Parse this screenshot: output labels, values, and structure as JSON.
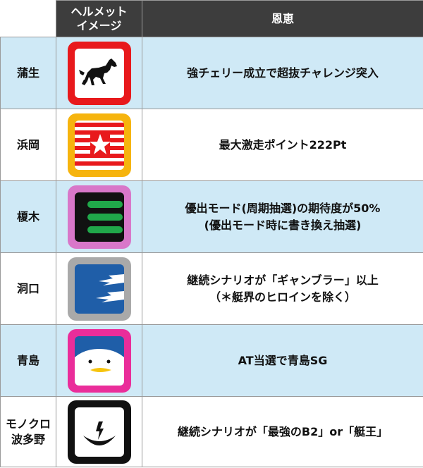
{
  "header": {
    "col_name": "",
    "col_helmet": "ヘルメット\nイメージ",
    "col_benefit": "恩恵"
  },
  "rows": [
    {
      "name": "蒲生",
      "benefit": "強チェリー成立で超抜チャレンジ突入",
      "icon": "horse-helmet-icon",
      "frame": "#e8191c"
    },
    {
      "name": "浜岡",
      "benefit": "最大激走ポイント222Pt",
      "icon": "star-stripes-helmet-icon",
      "frame": "#f6b40e"
    },
    {
      "name": "榎木",
      "benefit": "優出モード(周期抽選)の期待度が50%\n(優出モード時に書き換え抽選)",
      "icon": "green-bars-helmet-icon",
      "frame": "#d877c9"
    },
    {
      "name": "洞口",
      "benefit": "継続シナリオが「ギャンブラー」以上\n（＊艇界のヒロインを除く）",
      "icon": "lightning-helmet-icon",
      "frame": "#a9a9a9"
    },
    {
      "name": "青島",
      "benefit": "AT当選で青島SG",
      "icon": "penguin-helmet-icon",
      "frame": "#ea2d9a"
    },
    {
      "name": "モノクロ\n波多野",
      "benefit": "継続シナリオが「最強のB2」or「艇王」",
      "icon": "crescent-helmet-icon",
      "frame": "#111111"
    }
  ]
}
